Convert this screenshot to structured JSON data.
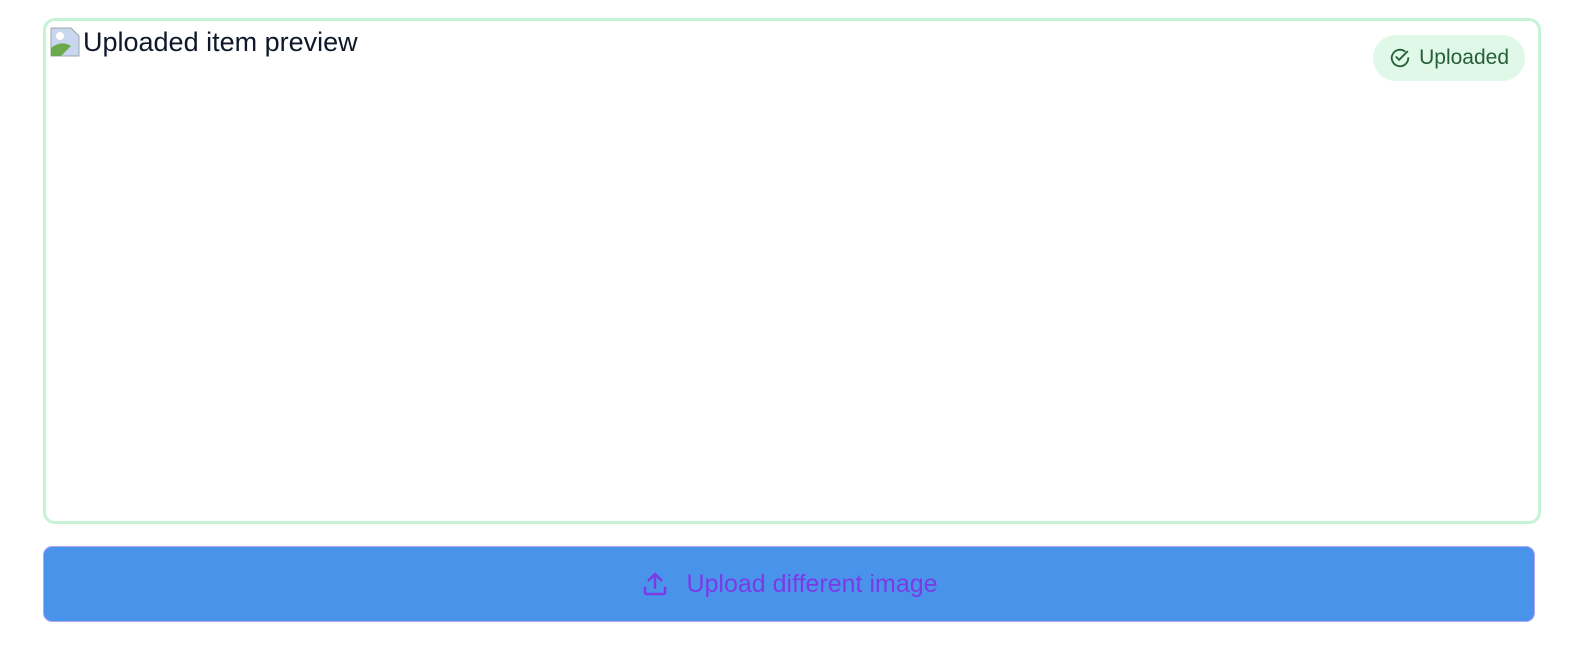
{
  "preview": {
    "alt_text": "Uploaded item preview"
  },
  "badge": {
    "label": "Uploaded",
    "icon": "check-circle-icon"
  },
  "upload_button": {
    "label": "Upload different image",
    "icon": "upload-icon"
  },
  "colors": {
    "border": "#c6f3d6",
    "badge_bg": "#e0f8e8",
    "badge_text": "#256038",
    "button_bg": "#4a93ea",
    "button_text": "#7c3ae6"
  }
}
